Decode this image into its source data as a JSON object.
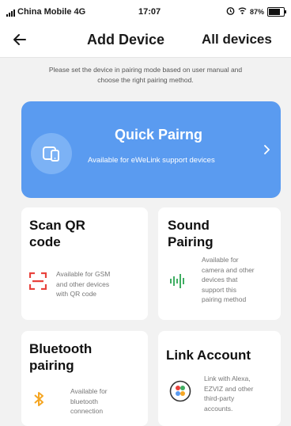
{
  "status_bar": {
    "carrier": "China Mobile 4G",
    "time": "17:07",
    "battery": "87%"
  },
  "nav": {
    "title": "Add Device",
    "all_devices": "All devices"
  },
  "instructions": {
    "line1": "Please set the device in pairing mode based on user manual and",
    "line2": "choose the right pairing method."
  },
  "quick_pairing": {
    "title": "Quick Pairng",
    "desc": "Available for eWeLink support devices"
  },
  "cards": {
    "qr": {
      "title_1": "Scan QR",
      "title_2": "code",
      "desc_1": "Available for GSM",
      "desc_2": "and other devices",
      "desc_3": "with QR code"
    },
    "sound": {
      "title_1": "Sound",
      "title_2": "Pairing",
      "desc_1": "Available for",
      "desc_2": "camera and other",
      "desc_3": "devices that",
      "desc_4": "support this",
      "desc_5": "pairing method"
    },
    "bluetooth": {
      "title_1": "Bluetooth",
      "title_2": "pairing",
      "desc_1": "Available for",
      "desc_2": "bluetooth",
      "desc_3": "connection"
    },
    "link": {
      "title": "Link Account",
      "desc_1": "Link with Alexa,",
      "desc_2": "EZVIZ and other",
      "desc_3": "third-party",
      "desc_4": "accounts."
    }
  },
  "colors": {
    "accent_blue": "#5a9bf0",
    "qr_red": "#e8413b",
    "sound_green": "#3fae62",
    "bluetooth_orange": "#f5a623"
  },
  "icons": {
    "back": "arrow-left-icon",
    "quick": "phone-device-icon",
    "chevron": "chevron-right-icon",
    "qr": "qr-scan-icon",
    "sound": "sound-wave-icon",
    "bluetooth": "bluetooth-icon",
    "link": "link-account-icon"
  }
}
